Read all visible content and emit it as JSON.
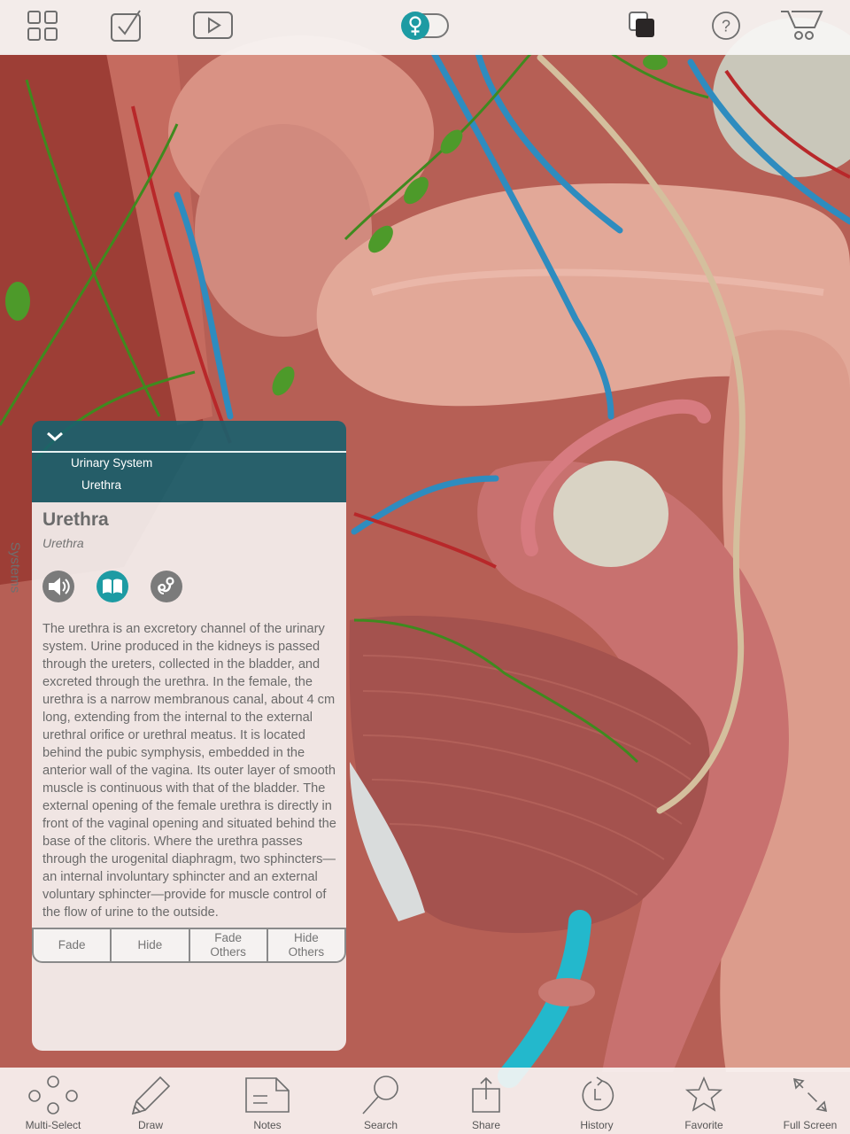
{
  "top_toolbar": {
    "icons": [
      {
        "name": "grid-icon",
        "label": "Home"
      },
      {
        "name": "checkbox-icon",
        "label": "Quiz"
      },
      {
        "name": "play-icon",
        "label": "Animations"
      },
      {
        "name": "female-toggle-icon",
        "label": "Female / Male"
      },
      {
        "name": "layers-icon",
        "label": "Layers"
      },
      {
        "name": "help-icon",
        "label": "Help"
      },
      {
        "name": "cart-icon",
        "label": "Store"
      }
    ],
    "gender_toggle": {
      "selected": "female",
      "symbol": "♀"
    },
    "help_symbol": "?"
  },
  "side_tab": {
    "label": "Systems"
  },
  "info_panel": {
    "collapse_icon": "chevron-down-icon",
    "breadcrumb": {
      "system": "Urinary System",
      "structure": "Urethra"
    },
    "title": "Urethra",
    "latin_name": "Urethra",
    "buttons": [
      {
        "name": "pronunciation-button",
        "icon": "speaker-icon",
        "active": false
      },
      {
        "name": "definition-button",
        "icon": "book-icon",
        "active": true
      },
      {
        "name": "clinical-button",
        "icon": "stethoscope-icon",
        "active": false
      }
    ],
    "description": "The urethra is an excretory channel of the urinary system. Urine produced in the kidneys is passed through the ureters, collected in the bladder, and excreted through the urethra. In the female, the urethra is a narrow membranous canal, about 4 cm long, extending from the internal to the external urethral orifice or urethral meatus. It is located behind the pubic symphysis, embedded in the anterior wall of the vagina. Its outer layer of smooth muscle is continuous with that of the bladder. The external opening of the female urethra is directly in front of the vaginal opening and situated behind the base of the clitoris. Where the urethra passes through the urogenital diaphragm, two sphincters—an internal involuntary sphincter and an external voluntary sphincter—provide for muscle control of the flow of urine to the outside.",
    "actions": {
      "fade": "Fade",
      "hide": "Hide",
      "fade_others_1": "Fade",
      "fade_others_2": "Others",
      "hide_others_1": "Hide",
      "hide_others_2": "Others"
    }
  },
  "bottom_toolbar": {
    "items": [
      {
        "label": "Multi-Select",
        "icon": "multi-select-icon"
      },
      {
        "label": "Draw",
        "icon": "pencil-icon"
      },
      {
        "label": "Notes",
        "icon": "note-icon"
      },
      {
        "label": "Search",
        "icon": "search-icon"
      },
      {
        "label": "Share",
        "icon": "share-icon"
      },
      {
        "label": "History",
        "icon": "history-icon"
      },
      {
        "label": "Favorite",
        "icon": "star-icon"
      },
      {
        "label": "Full Screen",
        "icon": "fullscreen-icon"
      }
    ]
  },
  "colors": {
    "accent_teal": "#1d9ba3",
    "panel_header": "#18606e",
    "icon_gray": "#6e6e6e",
    "selected_urethra": "#23b8cc"
  }
}
